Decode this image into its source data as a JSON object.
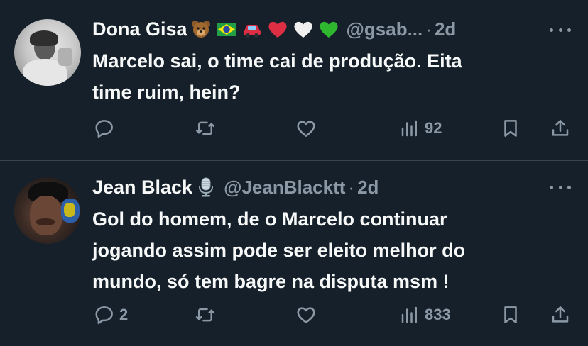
{
  "tweets": [
    {
      "name": "Dona Gisa",
      "emojis": [
        "bear-emoji",
        "brazil-flag-emoji",
        "red-car-emoji",
        "red-heart-emoji",
        "white-heart-emoji",
        "green-heart-emoji"
      ],
      "handle": "@gsab...",
      "separator": "·",
      "time": "2d",
      "text": "Marcelo sai, o time cai de produção.  Eita\ntime ruim, hein?",
      "replies": "",
      "views": "92"
    },
    {
      "name": "Jean Black",
      "emojis": [
        "microphone-emoji"
      ],
      "handle": "@JeanBlacktt",
      "separator": "·",
      "time": "2d",
      "text": "Gol do homem, de o Marcelo continuar\njogando assim pode ser eleito melhor do\nmundo, só tem bagre na disputa msm !",
      "replies": "2",
      "views": "833"
    }
  ],
  "colors": {
    "background": "#15202b",
    "text": "#f7f9f9",
    "muted": "#8b98a5",
    "divider": "#38444d"
  }
}
